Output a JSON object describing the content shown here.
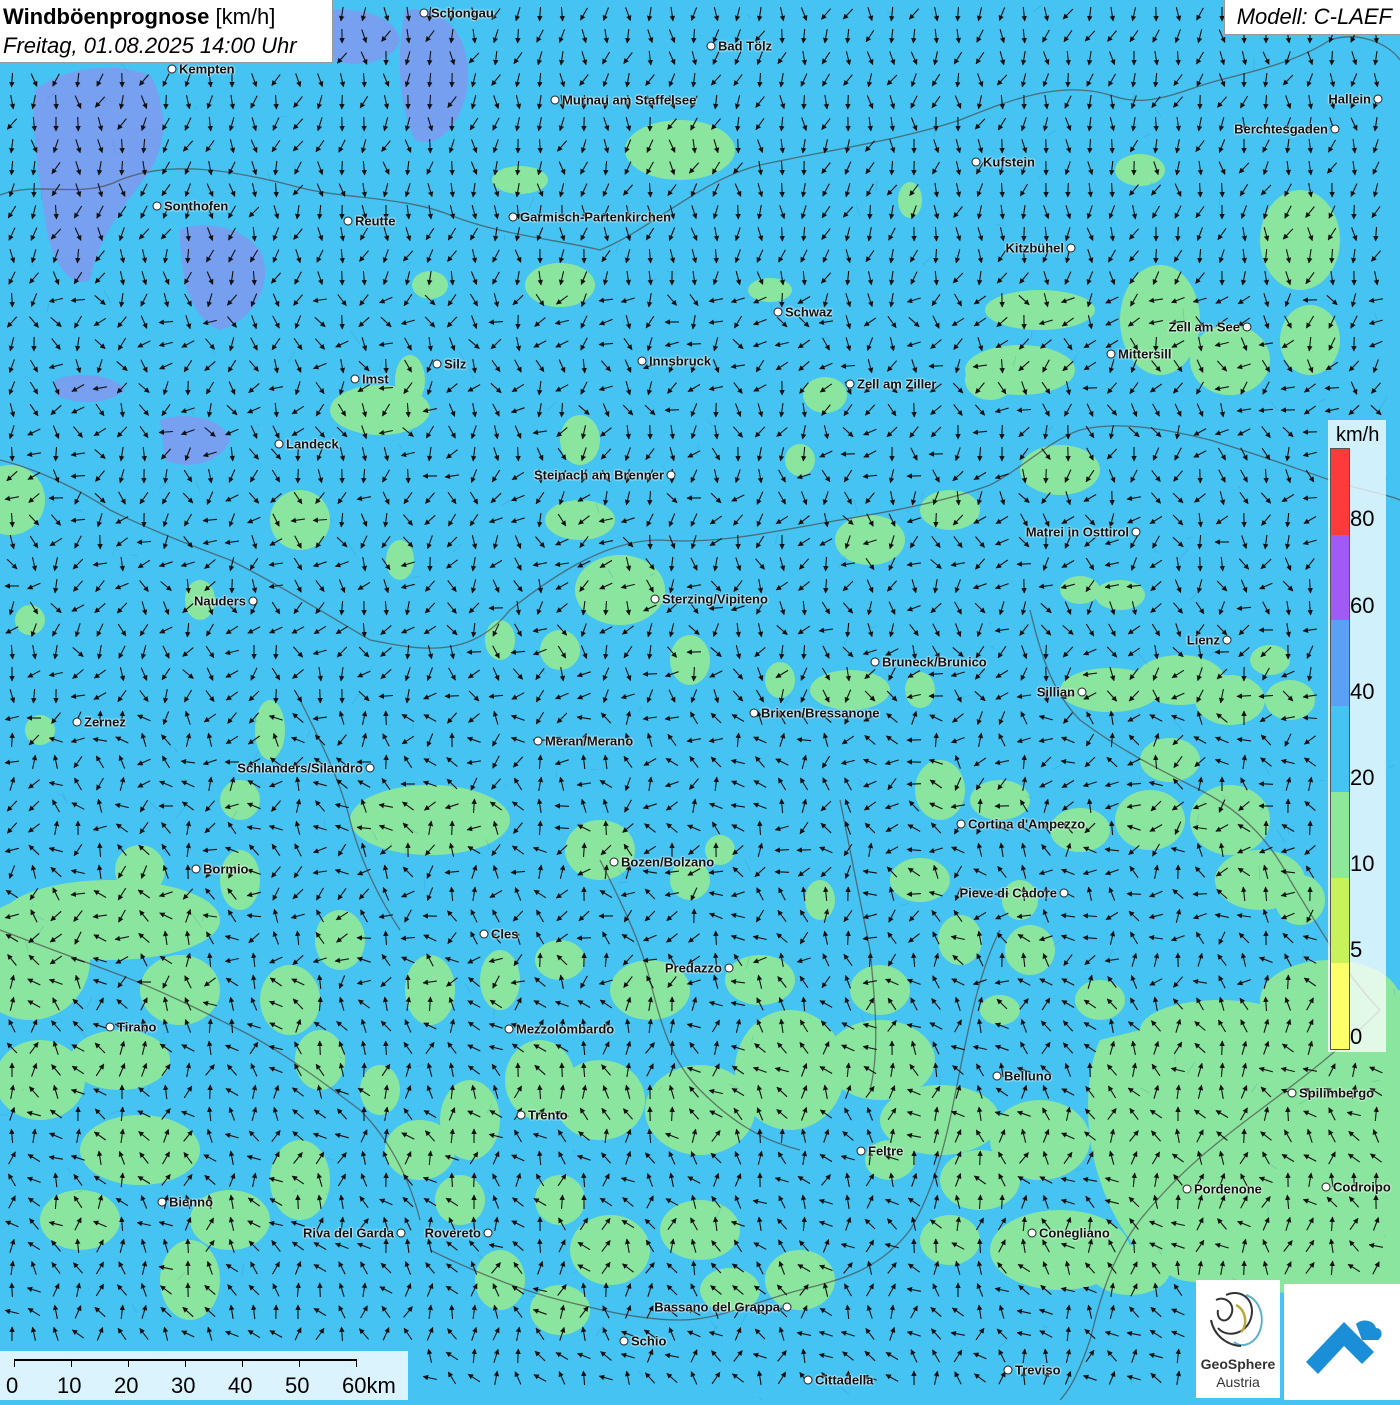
{
  "title": {
    "main": "Windböenprognose",
    "unit": "[km/h]",
    "datetime": "Freitag, 01.08.2025 14:00 Uhr"
  },
  "model": "Modell: C-LAEF",
  "legend": {
    "unit": "km/h",
    "ticks": [
      "80",
      "60",
      "40",
      "20",
      "10",
      "5",
      "0"
    ],
    "colors": [
      "#ff3a3a",
      "#a05af5",
      "#5aa0f5",
      "#45c3f2",
      "#8ee89a",
      "#c8f25a",
      "#ffff6a"
    ]
  },
  "scale": {
    "labels": [
      "0",
      "10",
      "20",
      "30",
      "40",
      "50",
      "60km"
    ]
  },
  "logos": {
    "geosphere_line1": "GeoSphere",
    "geosphere_line2": "Austria"
  },
  "cities": [
    {
      "name": "Schongau",
      "label_side": "right"
    },
    {
      "name": "Bad Tölz",
      "label_side": "right"
    },
    {
      "name": "Kempten",
      "label_side": "right"
    },
    {
      "name": "Murnau am Staffelsee",
      "label_side": "right"
    },
    {
      "name": "Hallein",
      "label_side": "left"
    },
    {
      "name": "Berchtesgaden",
      "label_side": "left"
    },
    {
      "name": "Kufstein",
      "label_side": "right"
    },
    {
      "name": "Sonthofen",
      "label_side": "right"
    },
    {
      "name": "Reutte",
      "label_side": "right"
    },
    {
      "name": "Garmisch-Partenkirchen",
      "label_side": "right"
    },
    {
      "name": "Kitzbühel",
      "label_side": "left"
    },
    {
      "name": "Schwaz",
      "label_side": "right"
    },
    {
      "name": "Zell am See",
      "label_side": "left"
    },
    {
      "name": "Innsbruck",
      "label_side": "right"
    },
    {
      "name": "Mittersill",
      "label_side": "right"
    },
    {
      "name": "Silz",
      "label_side": "right"
    },
    {
      "name": "Imst",
      "label_side": "right"
    },
    {
      "name": "Zell am Ziller",
      "label_side": "right"
    },
    {
      "name": "Landeck",
      "label_side": "right"
    },
    {
      "name": "Steinach am Brenner",
      "label_side": "left"
    },
    {
      "name": "Matrei in Osttirol",
      "label_side": "left"
    },
    {
      "name": "Nauders",
      "label_side": "left"
    },
    {
      "name": "Sterzing/Vipiteno",
      "label_side": "right"
    },
    {
      "name": "Lienz",
      "label_side": "left"
    },
    {
      "name": "Bruneck/Brunico",
      "label_side": "right"
    },
    {
      "name": "Sillian",
      "label_side": "left"
    },
    {
      "name": "Brixen/Bressanone",
      "label_side": "right"
    },
    {
      "name": "Zernez",
      "label_side": "right"
    },
    {
      "name": "Meran/Merano",
      "label_side": "right"
    },
    {
      "name": "Schlanders/Silandro",
      "label_side": "left"
    },
    {
      "name": "Cortina d'Ampezzo",
      "label_side": "right"
    },
    {
      "name": "Bozen/Bolzano",
      "label_side": "right"
    },
    {
      "name": "Bormio",
      "label_side": "right"
    },
    {
      "name": "Pieve di Cadore",
      "label_side": "left"
    },
    {
      "name": "Cles",
      "label_side": "right"
    },
    {
      "name": "Predazzo",
      "label_side": "left"
    },
    {
      "name": "Tirano",
      "label_side": "right"
    },
    {
      "name": "Mezzolombardo",
      "label_side": "right"
    },
    {
      "name": "Belluno",
      "label_side": "right"
    },
    {
      "name": "Spilimbergo",
      "label_side": "right"
    },
    {
      "name": "Trento",
      "label_side": "right"
    },
    {
      "name": "Feltre",
      "label_side": "right"
    },
    {
      "name": "Pordenone",
      "label_side": "right"
    },
    {
      "name": "Codroipo",
      "label_side": "right"
    },
    {
      "name": "Bienno",
      "label_side": "right"
    },
    {
      "name": "Riva del Garda",
      "label_side": "left"
    },
    {
      "name": "Rovereto",
      "label_side": "left"
    },
    {
      "name": "Conegliano",
      "label_side": "right"
    },
    {
      "name": "Bassano del Grappa",
      "label_side": "left"
    },
    {
      "name": "Schio",
      "label_side": "right"
    },
    {
      "name": "Treviso",
      "label_side": "right"
    },
    {
      "name": "Cittadella",
      "label_side": "right"
    }
  ]
}
